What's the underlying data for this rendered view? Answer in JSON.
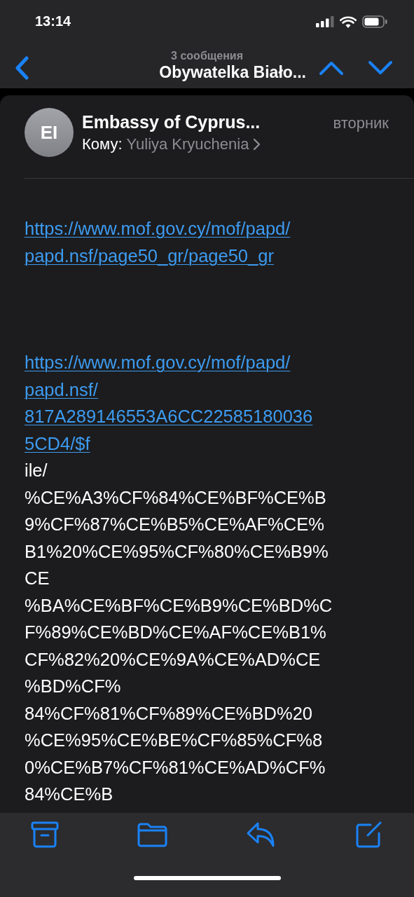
{
  "status_bar": {
    "time": "13:14"
  },
  "nav_bar": {
    "subtitle": "3 сообщения",
    "title": "Obywatelka Biało..."
  },
  "message": {
    "sender_initials": "EI",
    "sender": "Embassy of Cyprus...",
    "date": "вторник",
    "to_label": "Кому:",
    "recipient": "Yuliya Kryuchenia"
  },
  "body": [
    {
      "lines": [
        {
          "kind": "link",
          "text": "https://www.mof.gov.cy/mof/papd/"
        },
        {
          "kind": "link",
          "text": "papd.nsf/page50_gr/page50_gr"
        }
      ]
    },
    {
      "lines": [
        {
          "kind": "link",
          "text": "https://www.mof.gov.cy/mof/papd/"
        },
        {
          "kind": "link",
          "text": "papd.nsf/"
        },
        {
          "kind": "link",
          "text": "817A289146553A6CC22585180036"
        },
        {
          "kind": "link",
          "text": "5CD4/$f"
        },
        {
          "kind": "text",
          "text": "ile/"
        },
        {
          "kind": "text",
          "text": "%CE%A3%CF%84%CE%BF%CE%B"
        },
        {
          "kind": "text",
          "text": "9%CF%87%CE%B5%CE%AF%CE%"
        },
        {
          "kind": "text",
          "text": "B1%20%CE%95%CF%80%CE%B9%"
        },
        {
          "kind": "text",
          "text": "CE"
        },
        {
          "kind": "text",
          "text": "%BA%CE%BF%CE%B9%CE%BD%C"
        },
        {
          "kind": "text",
          "text": "F%89%CE%BD%CE%AF%CE%B1%"
        },
        {
          "kind": "text",
          "text": "CF%82%20%CE%9A%CE%AD%CE"
        },
        {
          "kind": "text",
          "text": "%BD%CF%"
        },
        {
          "kind": "text",
          "text": "84%CF%81%CF%89%CE%BD%20"
        },
        {
          "kind": "text",
          "text": "%CE%95%CE%BE%CF%85%CF%8"
        },
        {
          "kind": "text",
          "text": "0%CE%B7%CF%81%CE%AD%CF%"
        },
        {
          "kind": "text",
          "text": "84%CE%B"
        }
      ]
    }
  ]
}
